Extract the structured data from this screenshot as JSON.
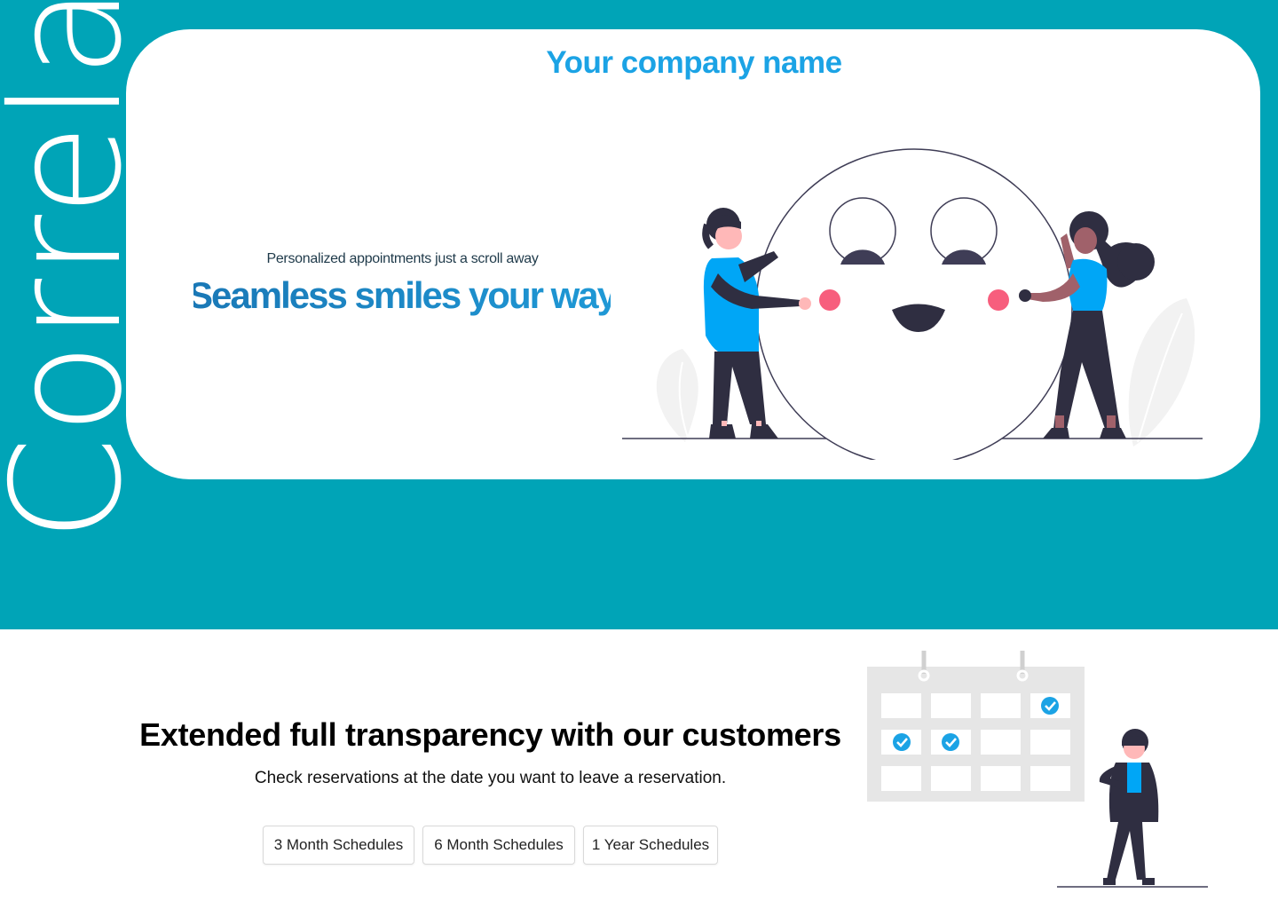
{
  "brand": {
    "vertical_name": "Correla"
  },
  "hero": {
    "company_name": "Your company name",
    "tagline": "Personalized appointments just a scroll away",
    "headline": "Seamless smiles your way",
    "illustration_icon": "people-holding-smiley-face-illustration"
  },
  "feature": {
    "title": "Extended full transparency with our customers",
    "subtitle": "Check reservations at the date you want to leave a reservation.",
    "buttons": [
      {
        "label": "3 Month Schedules"
      },
      {
        "label": "6 Month Schedules"
      },
      {
        "label": "1 Year Schedules"
      }
    ],
    "illustration_icon": "calendar-with-person-illustration"
  },
  "colors": {
    "hero_background": "#00a4b7",
    "card_background": "#ffffff",
    "company_name": "#1ba3e5",
    "headline_gradient_start": "#1a78b6",
    "headline_gradient_end": "#1f99d6",
    "accent_blue": "#00a6f6",
    "dark": "#2f2e41",
    "check_blue": "#1ba3e5",
    "cheek_pink": "#f75e7d"
  }
}
